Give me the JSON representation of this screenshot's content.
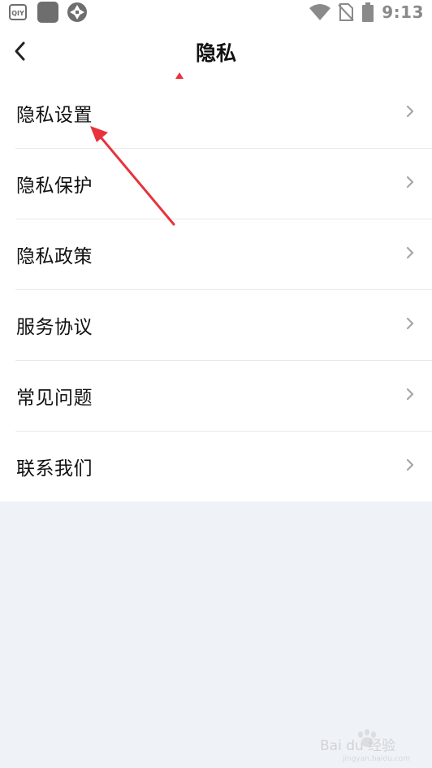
{
  "status_bar": {
    "time": "9:13",
    "left_icons": [
      "iqiyi-icon",
      "app-square-icon",
      "aperture-icon"
    ],
    "right_icons": [
      "wifi-icon",
      "no-sim-icon",
      "battery-icon"
    ]
  },
  "header": {
    "back_icon": "chevron-left-icon",
    "title": "隐私"
  },
  "menu": {
    "items": [
      {
        "label": "隐私设置",
        "icon": "chevron-right-icon"
      },
      {
        "label": "隐私保护",
        "icon": "chevron-right-icon"
      },
      {
        "label": "隐私政策",
        "icon": "chevron-right-icon"
      },
      {
        "label": "服务协议",
        "icon": "chevron-right-icon"
      },
      {
        "label": "常见问题",
        "icon": "chevron-right-icon"
      },
      {
        "label": "联系我们",
        "icon": "chevron-right-icon"
      }
    ]
  },
  "annotation": {
    "color": "#e8323c",
    "target": "隐私设置"
  },
  "watermark": {
    "logo": "Bai du 经验",
    "url": "jingyan.baidu.com"
  },
  "colors": {
    "page_background": "#eff3f8",
    "surface": "#ffffff",
    "divider": "#e9e9ec",
    "chevron": "#a6a6a6",
    "status_icons": "#8a8a8a"
  }
}
